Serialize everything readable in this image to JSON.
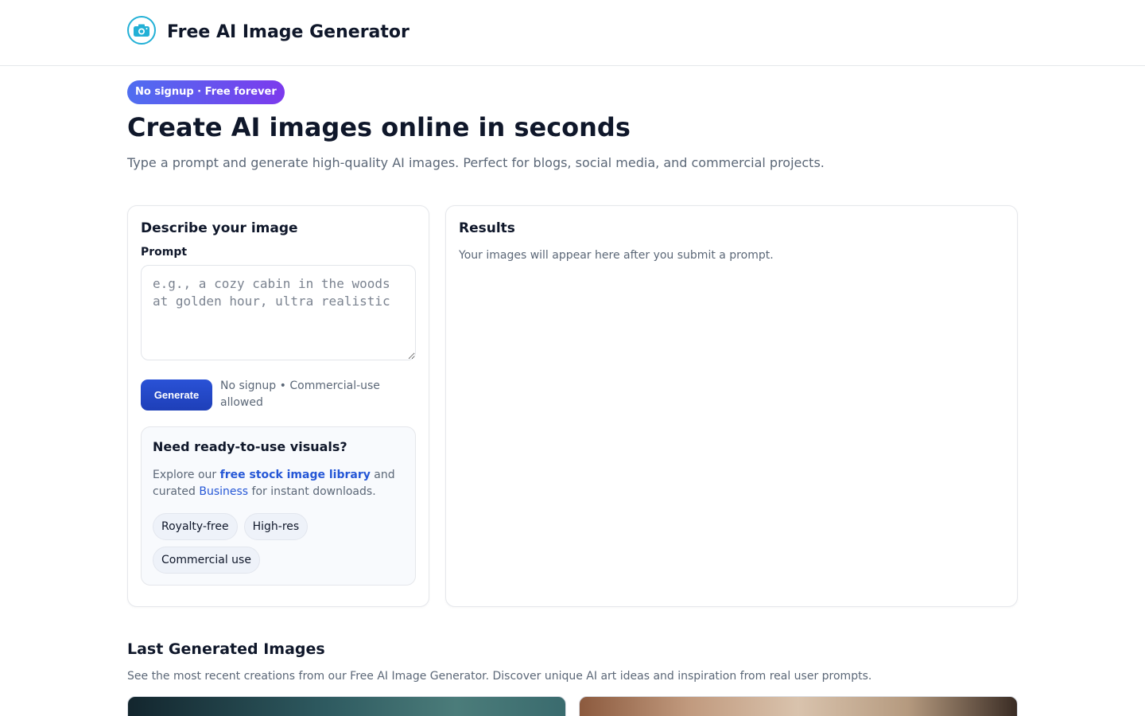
{
  "header": {
    "title": "Free AI Image Generator",
    "logo_icon": "camera-icon",
    "accent_color": "#22b0d6"
  },
  "hero": {
    "badge": "No signup · Free forever",
    "title": "Create AI images online in seconds",
    "subtitle": "Type a prompt and generate high-quality AI images. Perfect for blogs, social media, and commercial projects."
  },
  "form": {
    "title": "Describe your image",
    "prompt_label": "Prompt",
    "prompt_value": "",
    "prompt_placeholder": "e.g., a cozy cabin in the woods at golden hour, ultra realistic",
    "generate_label": "Generate",
    "generate_note": "No signup • Commercial-use allowed"
  },
  "promo": {
    "title": "Need ready-to-use visuals?",
    "text_before": "Explore our ",
    "link1": "free stock image library",
    "text_middle": " and curated ",
    "link2": "Business",
    "text_after": " for instant downloads.",
    "chips": [
      "Royalty-free",
      "High-res",
      "Commercial use"
    ]
  },
  "results": {
    "title": "Results",
    "empty_text": "Your images will appear here after you submit a prompt."
  },
  "gallery": {
    "title": "Last Generated Images",
    "subtitle": "See the most recent creations from our Free AI Image Generator. Discover unique AI art ideas and inspiration from real user prompts."
  }
}
